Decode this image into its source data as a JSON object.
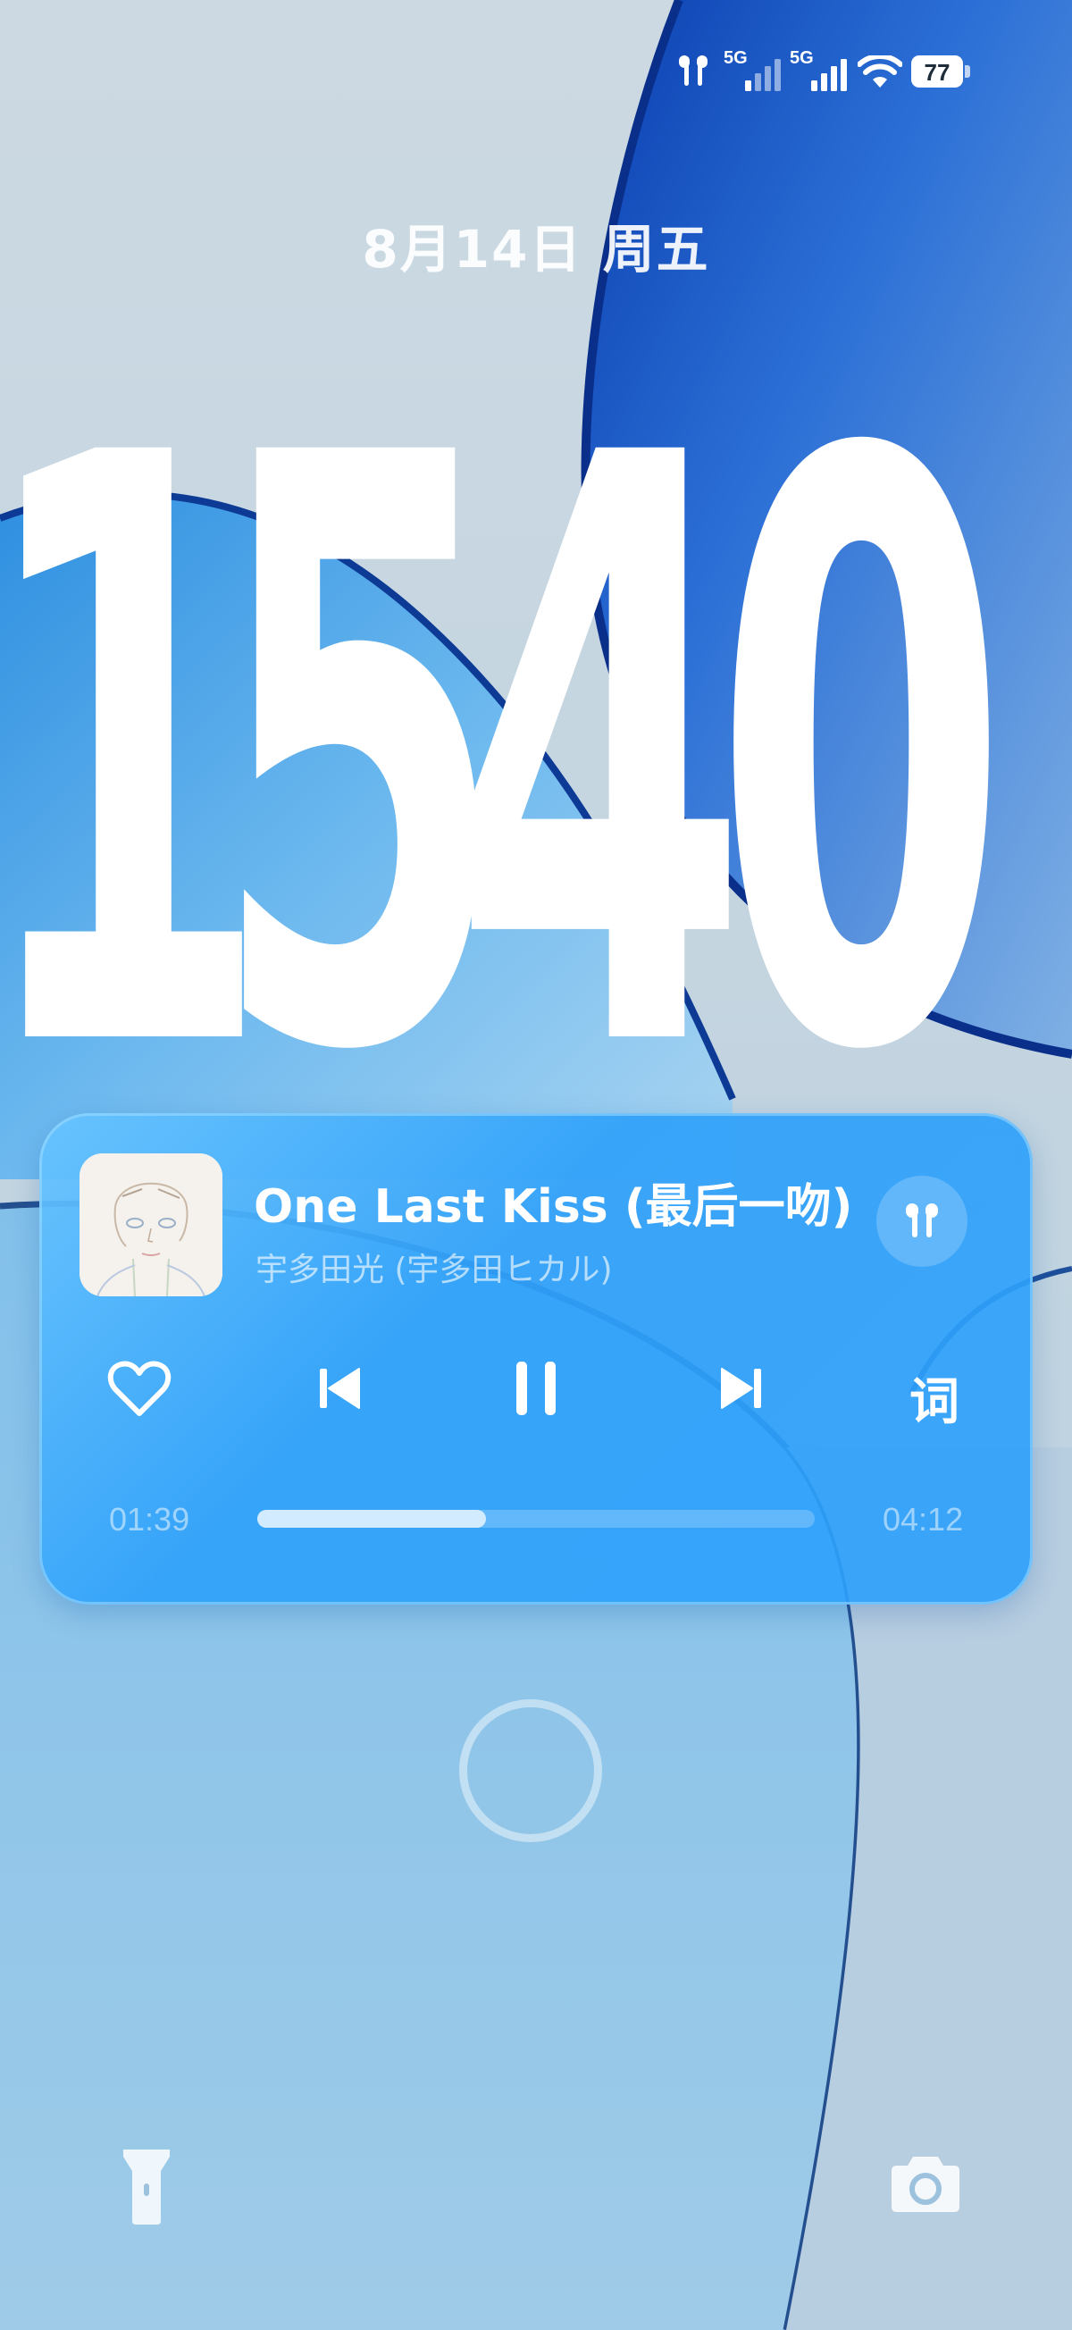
{
  "status_bar": {
    "icons": [
      "airpods-icon",
      "5g-signal-icon",
      "5g-signal-icon",
      "wifi-icon",
      "battery-icon"
    ],
    "network_1": "5G",
    "network_2": "5G",
    "battery_level": "77"
  },
  "lockscreen": {
    "date": "8月14日 周五",
    "time_digits": [
      "1",
      "5",
      "4",
      "0"
    ]
  },
  "player": {
    "title": "One Last Kiss (最后一吻)",
    "artist": "宇多田光 (宇多田ヒカル)",
    "elapsed": "01:39",
    "total": "04:12",
    "progress": 0.41,
    "lyrics_label": "词",
    "controls": [
      "heart-icon",
      "previous-icon",
      "pause-icon",
      "next-icon"
    ],
    "output_device_icon": "airpods-icon"
  },
  "bottom": {
    "left_shortcut_icon": "flashlight-icon",
    "right_shortcut_icon": "camera-icon"
  },
  "colors": {
    "accent": "#2fa0f8",
    "wallpaper_light": "#cfdde6",
    "wallpaper_deep": "#1f63c9"
  }
}
